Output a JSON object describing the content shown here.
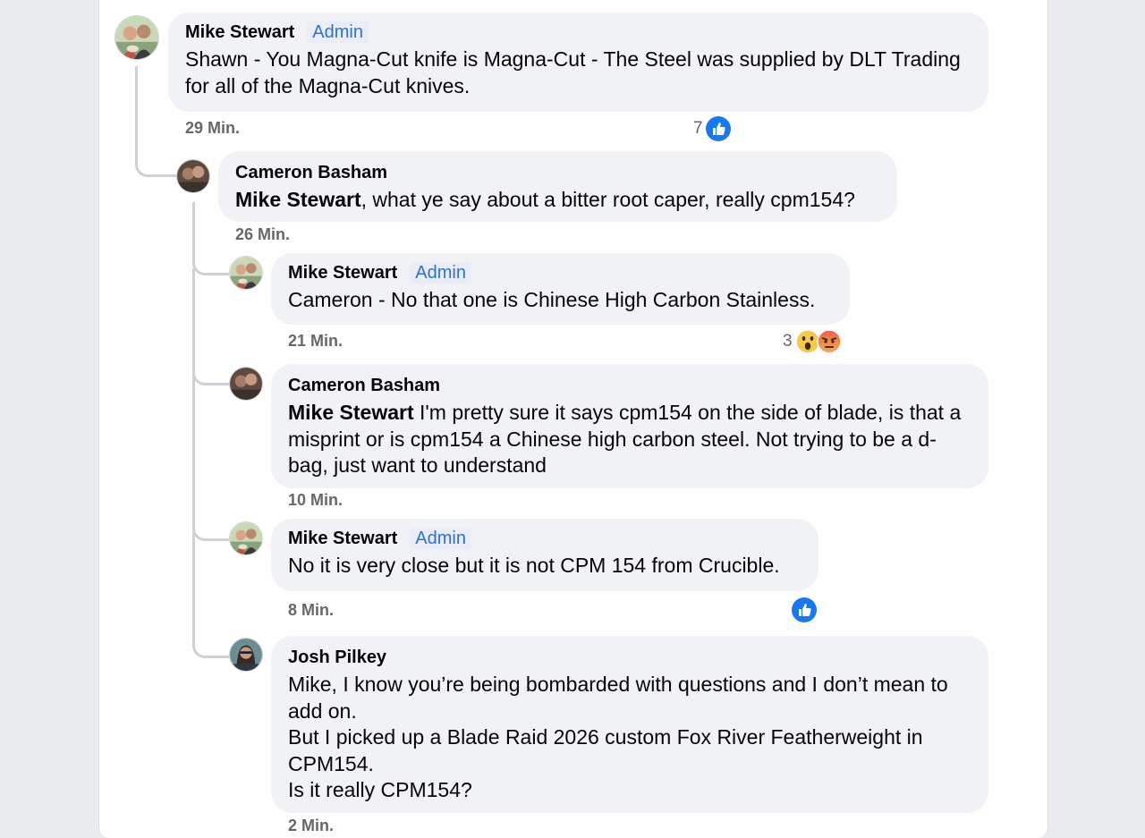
{
  "comments": [
    {
      "author": "Mike Stewart",
      "badge": "Admin",
      "mention": "",
      "text": "Shawn - You Magna-Cut knife is Magna-Cut - The Steel was supplied by DLT Trading for all of the Magna-Cut knives.",
      "time": "29 Min.",
      "reaction_count": "7",
      "reactions": [
        "like-icon"
      ]
    },
    {
      "author": "Cameron Basham",
      "mention": "Mike Stewart",
      "text": ", what ye say about a bitter root caper, really cpm154?",
      "time": "26 Min."
    },
    {
      "author": "Mike Stewart",
      "badge": "Admin",
      "text": "Cameron - No that one is Chinese High Carbon Stainless.",
      "time": "21 Min.",
      "reaction_count": "3",
      "reactions": [
        "wow-icon",
        "angry-icon"
      ]
    },
    {
      "author": "Cameron Basham",
      "mention": "Mike Stewart",
      "text": " I'm pretty sure it says cpm154 on the side of blade, is that a misprint or is cpm154 a Chinese high carbon steel. Not trying to be a d- bag, just want to understand",
      "time": "10 Min."
    },
    {
      "author": "Mike Stewart",
      "badge": "Admin",
      "text": "No it is very close but it is not CPM 154 from Crucible.",
      "time": "8 Min.",
      "reactions": [
        "like-icon"
      ]
    },
    {
      "author": "Josh Pilkey",
      "text_lines": [
        "Mike, I know you’re being bombarded with questions and I don’t mean to add on.",
        "But I picked up a Blade Raid 2026 custom Fox River Featherweight in CPM154.",
        "Is it really CPM154?"
      ],
      "time": "2 Min."
    }
  ],
  "colors": {
    "bubble": "#f0f2f5",
    "admin_badge": "#2f6fd6",
    "like_blue": "#1877f2",
    "timestamp": "#65676b"
  }
}
